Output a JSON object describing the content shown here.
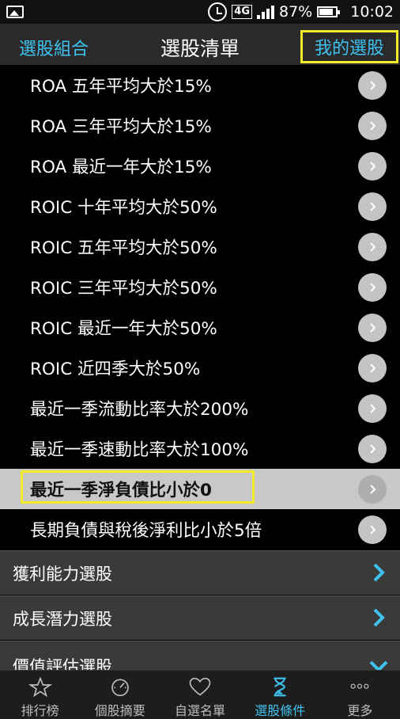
{
  "status_bar": {
    "battery": "87%",
    "time": "10:02",
    "network": "4G"
  },
  "header": {
    "left_label": "選股組合",
    "title": "選股清單",
    "right_label": "我的選股"
  },
  "list": [
    "ROA 五年平均大於15%",
    "ROA 三年平均大於15%",
    "ROA 最近一年大於15%",
    "ROIC 十年平均大於50%",
    "ROIC 五年平均大於50%",
    "ROIC 三年平均大於50%",
    "ROIC 最近一年大於50%",
    "ROIC 近四季大於50%",
    "最近一季流動比率大於200%",
    "最近一季速動比率大於100%",
    "最近一季淨負債比小於0",
    "長期負債與稅後淨利比小於5倍"
  ],
  "selected_index": 10,
  "categories": [
    {
      "label": "獲利能力選股",
      "state": "collapsed"
    },
    {
      "label": "成長潛力選股",
      "state": "collapsed"
    },
    {
      "label": "價值評估選股",
      "state": "expanded"
    }
  ],
  "bottom_nav": [
    {
      "label": "排行榜",
      "icon": "star-icon"
    },
    {
      "label": "個股摘要",
      "icon": "gauge-icon"
    },
    {
      "label": "自選名單",
      "icon": "heart-icon"
    },
    {
      "label": "選股條件",
      "icon": "hourglass-icon",
      "active": true
    },
    {
      "label": "更多",
      "icon": "more-dots-icon"
    }
  ],
  "colors": {
    "accent": "#3ec3f0",
    "highlight": "#f1ec2a"
  }
}
